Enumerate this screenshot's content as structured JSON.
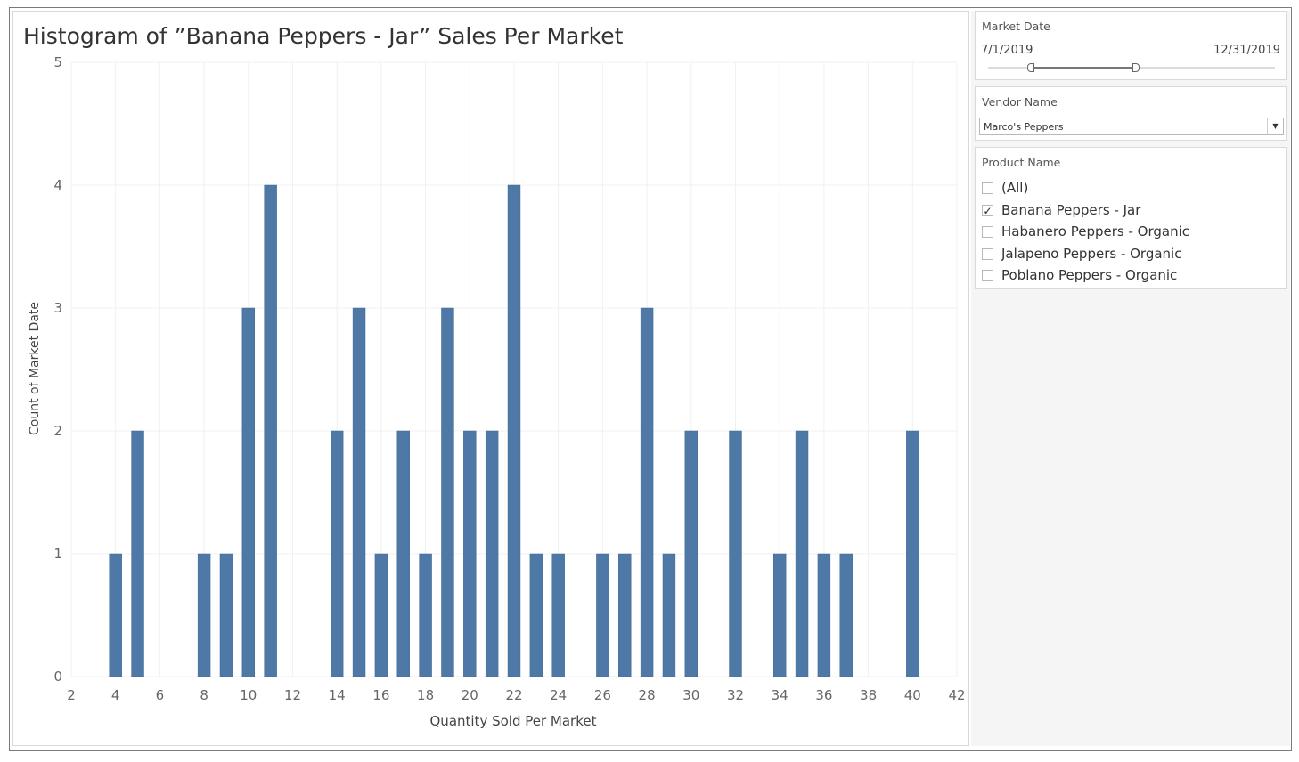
{
  "chart_data": {
    "type": "bar",
    "title": "Histogram of ”Banana Peppers - Jar” Sales Per Market",
    "xlabel": "Quantity Sold Per Market",
    "ylabel": "Count of Market Date",
    "xlim": [
      2,
      42
    ],
    "ylim": [
      0,
      5
    ],
    "xticks": [
      2,
      4,
      6,
      8,
      10,
      12,
      14,
      16,
      18,
      20,
      22,
      24,
      26,
      28,
      30,
      32,
      34,
      36,
      38,
      40,
      42
    ],
    "yticks": [
      0,
      1,
      2,
      3,
      4,
      5
    ],
    "bar_color": "#4e79a7",
    "grid": true,
    "bars": [
      {
        "x": 4,
        "count": 1
      },
      {
        "x": 5,
        "count": 2
      },
      {
        "x": 8,
        "count": 1
      },
      {
        "x": 9,
        "count": 1
      },
      {
        "x": 10,
        "count": 3
      },
      {
        "x": 11,
        "count": 4
      },
      {
        "x": 14,
        "count": 2
      },
      {
        "x": 15,
        "count": 3
      },
      {
        "x": 16,
        "count": 1
      },
      {
        "x": 17,
        "count": 2
      },
      {
        "x": 18,
        "count": 1
      },
      {
        "x": 19,
        "count": 3
      },
      {
        "x": 20,
        "count": 2
      },
      {
        "x": 21,
        "count": 2
      },
      {
        "x": 22,
        "count": 4
      },
      {
        "x": 23,
        "count": 1
      },
      {
        "x": 24,
        "count": 1
      },
      {
        "x": 26,
        "count": 1
      },
      {
        "x": 27,
        "count": 1
      },
      {
        "x": 28,
        "count": 3
      },
      {
        "x": 29,
        "count": 1
      },
      {
        "x": 30,
        "count": 2
      },
      {
        "x": 32,
        "count": 2
      },
      {
        "x": 34,
        "count": 1
      },
      {
        "x": 35,
        "count": 2
      },
      {
        "x": 36,
        "count": 1
      },
      {
        "x": 37,
        "count": 1
      },
      {
        "x": 40,
        "count": 2
      }
    ]
  },
  "filters": {
    "market_date": {
      "title": "Market Date",
      "start": "7/1/2019",
      "end": "12/31/2019"
    },
    "vendor": {
      "title": "Vendor Name",
      "selected": "Marco's Peppers"
    },
    "product": {
      "title": "Product Name",
      "options": [
        {
          "label": "(All)",
          "checked": false
        },
        {
          "label": "Banana Peppers - Jar",
          "checked": true
        },
        {
          "label": "Habanero Peppers - Organic",
          "checked": false
        },
        {
          "label": "Jalapeno Peppers - Organic",
          "checked": false
        },
        {
          "label": "Poblano Peppers - Organic",
          "checked": false
        }
      ]
    }
  }
}
